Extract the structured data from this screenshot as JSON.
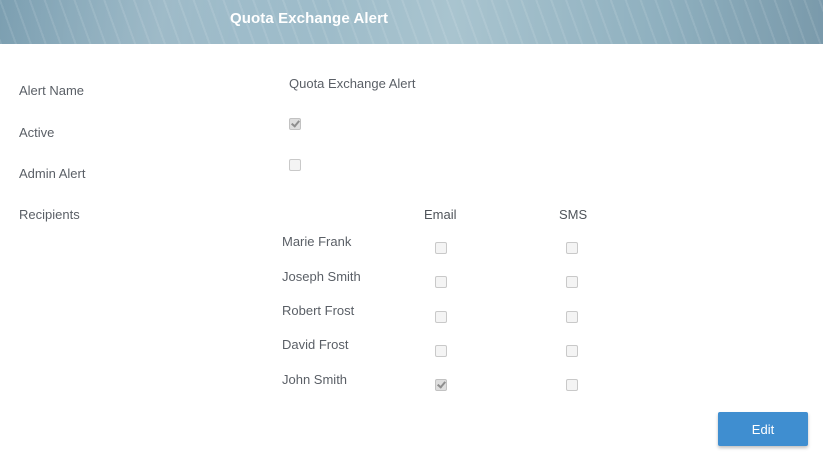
{
  "header": {
    "title": "Quota Exchange Alert"
  },
  "form": {
    "alert_name_label": "Alert Name",
    "alert_name_value": "Quota Exchange Alert",
    "active_label": "Active",
    "active_checked": true,
    "admin_alert_label": "Admin Alert",
    "admin_alert_checked": false,
    "recipients_label": "Recipients"
  },
  "recipients": {
    "columns": [
      "Email",
      "SMS"
    ],
    "rows": [
      {
        "name": "Marie Frank",
        "email": false,
        "sms": false
      },
      {
        "name": "Joseph Smith",
        "email": false,
        "sms": false
      },
      {
        "name": "Robert Frost",
        "email": false,
        "sms": false
      },
      {
        "name": "David Frost",
        "email": false,
        "sms": false
      },
      {
        "name": "John Smith",
        "email": true,
        "sms": false
      }
    ]
  },
  "actions": {
    "edit_label": "Edit"
  },
  "colors": {
    "accent": "#3f8ed0",
    "text": "#5a5f66"
  }
}
